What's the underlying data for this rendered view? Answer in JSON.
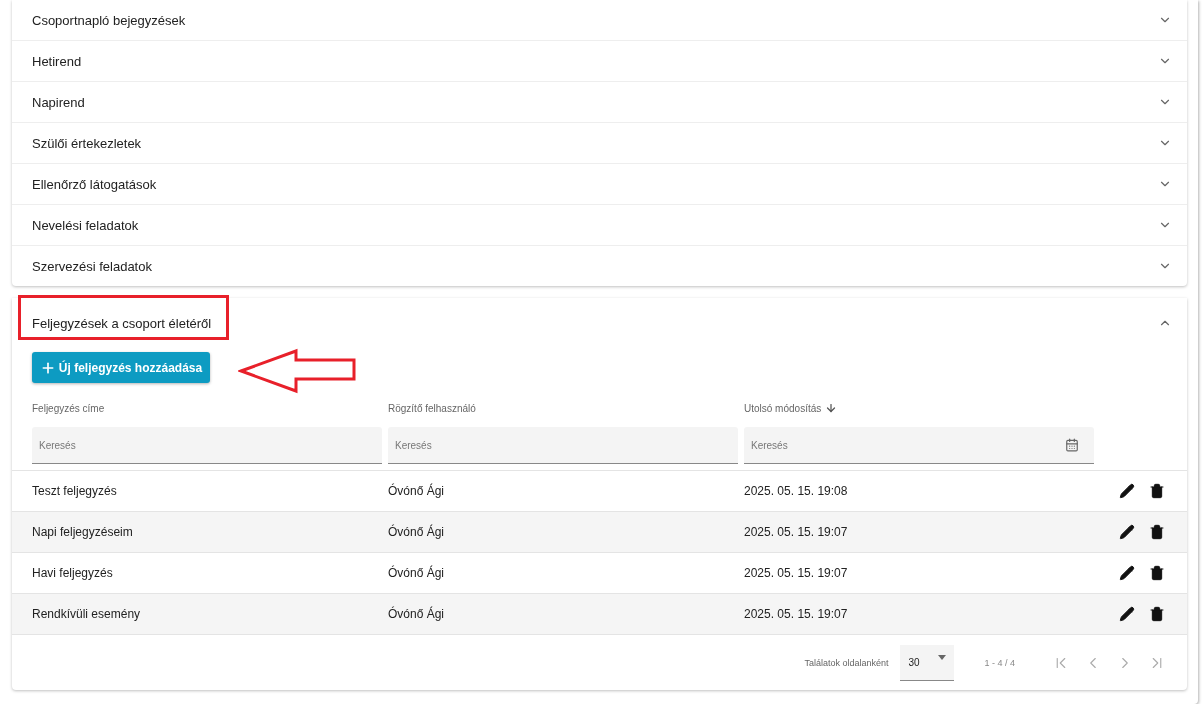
{
  "sections": [
    {
      "title": "Csoportnapló bejegyzések",
      "expanded": false
    },
    {
      "title": "Hetirend",
      "expanded": false
    },
    {
      "title": "Napirend",
      "expanded": false
    },
    {
      "title": "Szülői értekezletek",
      "expanded": false
    },
    {
      "title": "Ellenőrző látogatások",
      "expanded": false
    },
    {
      "title": "Nevelési feladatok",
      "expanded": false
    },
    {
      "title": "Szervezési feladatok",
      "expanded": false
    }
  ],
  "open_section": {
    "title": "Feljegyzések a csoport életéről",
    "expanded": true,
    "add_button": "Új feljegyzés hozzáadása",
    "columns": [
      {
        "label": "Feljegyzés címe",
        "sorted": false
      },
      {
        "label": "Rögzítő felhasználó",
        "sorted": false
      },
      {
        "label": "Utolsó módosítás",
        "sorted": true
      }
    ],
    "filters": [
      {
        "kind": "text",
        "placeholder": "Keresés"
      },
      {
        "kind": "text",
        "placeholder": "Keresés"
      },
      {
        "kind": "date",
        "placeholder": "Keresés"
      }
    ],
    "rows": [
      {
        "cells": [
          "Teszt feljegyzés",
          "Óvónő Ági",
          "2025. 05. 15. 19:08"
        ]
      },
      {
        "cells": [
          "Napi feljegyzéseim",
          "Óvónő Ági",
          "2025. 05. 15. 19:07"
        ]
      },
      {
        "cells": [
          "Havi feljegyzés",
          "Óvónő Ági",
          "2025. 05. 15. 19:07"
        ]
      },
      {
        "cells": [
          "Rendkívüli esemény",
          "Óvónő Ági",
          "2025. 05. 15. 19:07"
        ]
      }
    ],
    "pagination": {
      "per_page_label": "Találatok oldalanként",
      "per_page_value": "30",
      "range": "1 - 4 / 4",
      "buttons": [
        {
          "kind": "first",
          "disabled": true
        },
        {
          "kind": "prev",
          "disabled": true
        },
        {
          "kind": "next",
          "disabled": true
        },
        {
          "kind": "last",
          "disabled": true
        }
      ]
    }
  }
}
